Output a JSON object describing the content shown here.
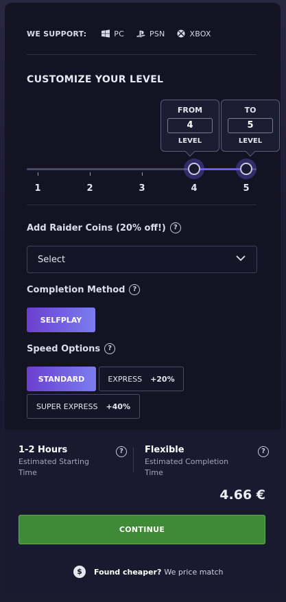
{
  "support": {
    "label": "WE SUPPORT:",
    "platforms": [
      {
        "name": "PC",
        "icon": "windows-icon"
      },
      {
        "name": "PSN",
        "icon": "playstation-icon"
      },
      {
        "name": "XBOX",
        "icon": "xbox-icon"
      }
    ]
  },
  "level": {
    "title": "CUSTOMIZE YOUR LEVEL",
    "from": {
      "head": "FROM",
      "value": "4",
      "foot": "LEVEL"
    },
    "to": {
      "head": "TO",
      "value": "5",
      "foot": "LEVEL"
    },
    "ticks": [
      "1",
      "2",
      "3",
      "4",
      "5"
    ],
    "selected_from": 4,
    "selected_to": 5
  },
  "coins": {
    "label": "Add Raider Coins (20% off!)",
    "help": "?",
    "select_value": "Select"
  },
  "completion": {
    "label": "Completion Method",
    "help": "?",
    "option": "SELFPLAY"
  },
  "speed": {
    "label": "Speed Options",
    "help": "?",
    "standard": "STANDARD",
    "express": {
      "label": "EXPRESS",
      "pct": "+20%"
    },
    "super_express": {
      "label": "SUPER EXPRESS",
      "pct": "+40%"
    }
  },
  "estimates": {
    "start": {
      "title": "1-2 Hours",
      "sub": "Estimated Starting Time"
    },
    "completion": {
      "title": "Flexible",
      "sub": "Estimated Completion Time"
    },
    "help": "?"
  },
  "price": "4.66 €",
  "continue_label": "CONTINUE",
  "cheaper": {
    "coin": "$",
    "bold": "Found cheaper?",
    "text": "We price match"
  },
  "colors": {
    "accent": "#6c5ce7",
    "continue": "#3f8a36",
    "panel": "#131324"
  }
}
